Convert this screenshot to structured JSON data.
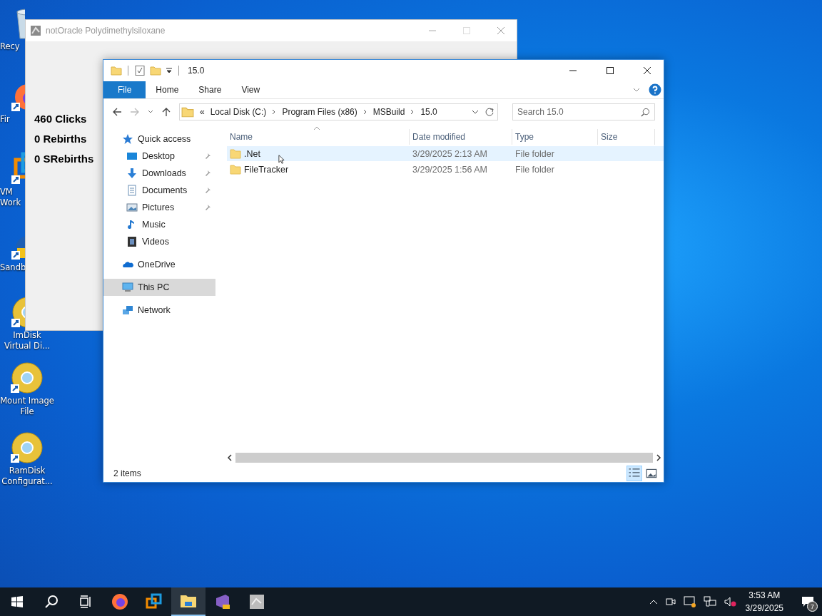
{
  "desktop_icons": [
    {
      "label": "Recy",
      "kind": "bin"
    },
    {
      "label": "Fir",
      "kind": "firefox"
    },
    {
      "label": "VM Work",
      "kind": "vmware"
    },
    {
      "label": "Sandb",
      "kind": "sandbox"
    },
    {
      "label": "ImDisk Virtual Di...",
      "kind": "disc"
    },
    {
      "label": "Mount Image File",
      "kind": "disc"
    },
    {
      "label": "RamDisk Configurat...",
      "kind": "disc"
    }
  ],
  "background_window": {
    "title": "notOracle Polydimethylsiloxane",
    "stats": [
      "460 Clicks",
      "0 Rebirths",
      "0 SRebirths"
    ]
  },
  "explorer": {
    "title": "15.0",
    "ribbon_tabs": [
      {
        "label": "File",
        "selected": true
      },
      {
        "label": "Home",
        "selected": false
      },
      {
        "label": "Share",
        "selected": false
      },
      {
        "label": "View",
        "selected": false
      }
    ],
    "address": {
      "overflow": "«",
      "crumbs": [
        "Local Disk (C:)",
        "Program Files (x86)",
        "MSBuild",
        "15.0"
      ]
    },
    "search": {
      "placeholder": "Search 15.0"
    },
    "nav": [
      {
        "label": "Quick access",
        "kind": "star",
        "selected": false,
        "children": [
          {
            "label": "Desktop",
            "kind": "desktop",
            "pinned": true,
            "selected": false
          },
          {
            "label": "Downloads",
            "kind": "downloads",
            "pinned": true,
            "selected": false
          },
          {
            "label": "Documents",
            "kind": "documents",
            "pinned": true,
            "selected": false
          },
          {
            "label": "Pictures",
            "kind": "pictures",
            "pinned": true,
            "selected": false
          },
          {
            "label": "Music",
            "kind": "music",
            "pinned": false,
            "selected": false
          },
          {
            "label": "Videos",
            "kind": "videos",
            "pinned": false,
            "selected": false
          }
        ]
      },
      {
        "label": "OneDrive",
        "kind": "cloud",
        "selected": false
      },
      {
        "label": "This PC",
        "kind": "pc",
        "selected": true
      },
      {
        "label": "Network",
        "kind": "network",
        "selected": false
      }
    ],
    "columns": [
      "Name",
      "Date modified",
      "Type",
      "Size"
    ],
    "rows": [
      {
        "name": ".Net",
        "date": "3/29/2025 2:13 AM",
        "type": "File folder",
        "selected": true
      },
      {
        "name": "FileTracker",
        "date": "3/29/2025 1:56 AM",
        "type": "File folder",
        "selected": false
      }
    ],
    "status": "2 items"
  },
  "taskbar": {
    "apps": [
      {
        "kind": "firefox",
        "active": false
      },
      {
        "kind": "vmware",
        "active": false
      },
      {
        "kind": "explorer",
        "active": true
      },
      {
        "kind": "studio",
        "active": false
      },
      {
        "kind": "app",
        "active": false
      }
    ],
    "time": "3:53 AM",
    "date": "3/29/2025",
    "notifications": "7"
  }
}
